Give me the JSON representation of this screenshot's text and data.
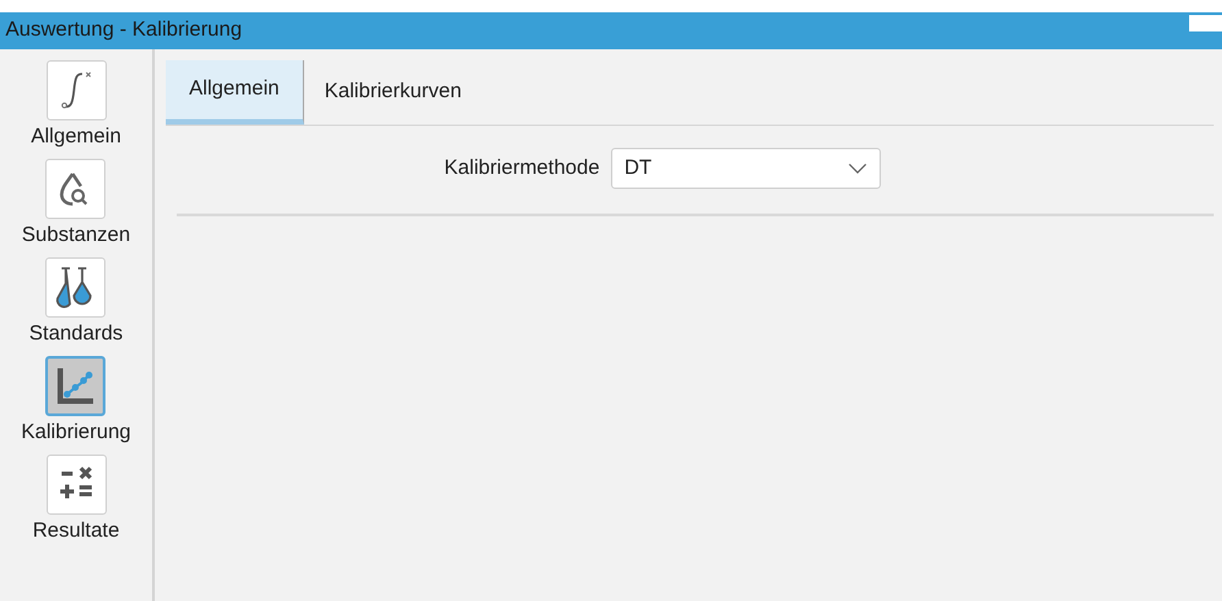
{
  "window": {
    "title": "Auswertung - Kalibrierung"
  },
  "sidebar": {
    "items": [
      {
        "label": "Allgemein",
        "kind": "integral",
        "selected": false
      },
      {
        "label": "Substanzen",
        "kind": "drop",
        "selected": false
      },
      {
        "label": "Standards",
        "kind": "flasks",
        "selected": false
      },
      {
        "label": "Kalibrierung",
        "kind": "curve",
        "selected": true
      },
      {
        "label": "Resultate",
        "kind": "math",
        "selected": false
      }
    ]
  },
  "tabs": [
    {
      "label": "Allgemein",
      "selected": true
    },
    {
      "label": "Kalibrierkurven",
      "selected": false
    }
  ],
  "form": {
    "label": "Kalibriermethode",
    "value": "DT"
  }
}
